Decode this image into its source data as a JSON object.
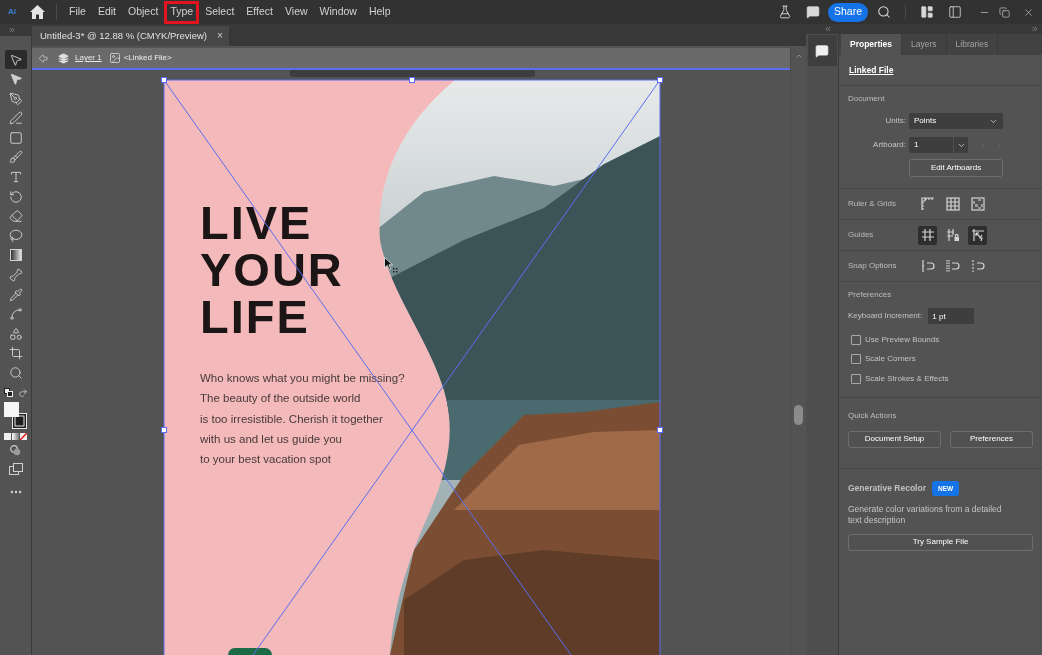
{
  "menu_bar": {
    "logo": "Ai",
    "items": [
      {
        "label": "File",
        "highlighted": false
      },
      {
        "label": "Edit",
        "highlighted": false
      },
      {
        "label": "Object",
        "highlighted": false
      },
      {
        "label": "Type",
        "highlighted": true
      },
      {
        "label": "Select",
        "highlighted": false
      },
      {
        "label": "Effect",
        "highlighted": false
      },
      {
        "label": "View",
        "highlighted": false
      },
      {
        "label": "Window",
        "highlighted": false
      },
      {
        "label": "Help",
        "highlighted": false
      }
    ],
    "share_button": "Share"
  },
  "tools": [
    {
      "kind": "selection",
      "selected": true
    },
    {
      "kind": "direct-selection",
      "selected": false
    },
    {
      "kind": "pen",
      "selected": false
    },
    {
      "kind": "curvature",
      "selected": false
    },
    {
      "kind": "rectangle",
      "selected": false
    },
    {
      "kind": "paintbrush",
      "selected": false
    },
    {
      "kind": "type",
      "selected": false
    },
    {
      "kind": "rotate",
      "selected": false
    },
    {
      "kind": "eraser",
      "selected": false
    },
    {
      "kind": "lasso",
      "selected": false
    },
    {
      "kind": "gradient",
      "selected": false
    },
    {
      "kind": "width",
      "selected": false
    },
    {
      "kind": "eyedropper",
      "selected": false
    },
    {
      "kind": "warp",
      "selected": false
    },
    {
      "kind": "shape-builder",
      "selected": false
    },
    {
      "kind": "artboard",
      "selected": false
    },
    {
      "kind": "zoom",
      "selected": false
    }
  ],
  "document_tab": {
    "title": "Untitled-3* @ 12.88 % (CMYK/Preview)",
    "close": "×"
  },
  "breadcrumb": {
    "layer": "Layer 1",
    "object": "<Linked File>"
  },
  "artboard": {
    "headline": "LIVE YOUR LIFE",
    "body_lines": [
      "Who knows what you might be missing?",
      "The beauty of the outside world",
      "is too irresistible. Cherish it together",
      "with us and let us guide you",
      "to your best vacation spot"
    ]
  },
  "properties_panel": {
    "tabs": [
      {
        "label": "Properties",
        "selected": true
      },
      {
        "label": "Layers",
        "selected": false
      },
      {
        "label": "Libraries",
        "selected": false
      }
    ],
    "object_type": "Linked File",
    "document": {
      "heading": "Document",
      "units_label": "Units:",
      "units_value": "Points",
      "artboard_label": "Artboard:",
      "artboard_value": "1",
      "artboard_nav_disabled": true,
      "edit_button": "Edit Artboards"
    },
    "ruler_grids": {
      "label": "Ruler & Grids",
      "toggles": [
        {
          "kind": "rulers",
          "on": false
        },
        {
          "kind": "grid",
          "on": false
        },
        {
          "kind": "transparency-grid",
          "on": false
        }
      ]
    },
    "guides": {
      "label": "Guides",
      "toggles": [
        {
          "kind": "guides",
          "on": true
        },
        {
          "kind": "lock-guides",
          "on": false
        },
        {
          "kind": "smart-guides",
          "on": true
        }
      ]
    },
    "snap_options": {
      "label": "Snap Options",
      "toggles": [
        {
          "kind": "snap-point",
          "on": false
        },
        {
          "kind": "snap-pixel",
          "on": false
        },
        {
          "kind": "snap-glyph",
          "on": false
        }
      ]
    },
    "preferences": {
      "heading": "Preferences",
      "keyboard_increment_label": "Keyboard Increment:",
      "keyboard_increment_value": "1 pt",
      "checkboxes": [
        {
          "label": "Use Preview Bounds",
          "checked": false
        },
        {
          "label": "Scale Corners",
          "checked": false
        },
        {
          "label": "Scale Strokes & Effects",
          "checked": false
        }
      ]
    },
    "quick_actions": {
      "heading": "Quick Actions",
      "buttons": [
        "Document Setup",
        "Preferences"
      ]
    },
    "generative_recolor": {
      "title": "Generative Recolor",
      "badge": "NEW",
      "description": "Generate color variations from a detailed text description",
      "button": "Try Sample File"
    }
  }
}
